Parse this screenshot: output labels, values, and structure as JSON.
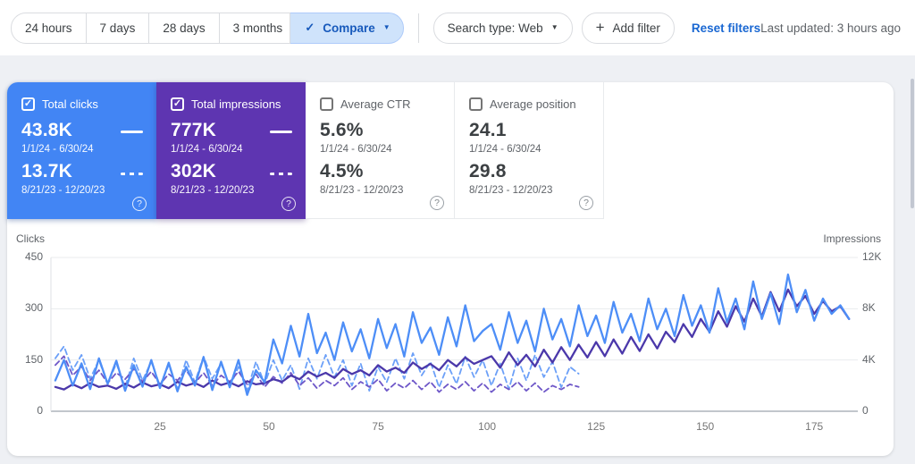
{
  "toolbar": {
    "time_ranges": [
      "24 hours",
      "7 days",
      "28 days",
      "3 months"
    ],
    "compare_label": "Compare",
    "search_type_label": "Search type: Web",
    "add_filter_label": "Add filter",
    "reset_filters_label": "Reset filters",
    "last_updated": "Last updated: 3 hours ago"
  },
  "icons": {
    "check": "✓",
    "caret_down": "▼",
    "plus": "+",
    "question": "?"
  },
  "colors": {
    "clicks_card": "#4285f4",
    "impressions_card": "#5e35b1",
    "compare_bg": "#cfe3fb",
    "link_blue": "#1967d2",
    "clicks_line": "#4d8ef7",
    "clicks_line_prev": "#6ca0f8",
    "impressions_line": "#4b38aa",
    "impressions_line_prev": "#6e57c8"
  },
  "cards": [
    {
      "label": "Total clicks",
      "checked": true,
      "current_value": "43.8K",
      "current_range": "1/1/24 - 6/30/24",
      "previous_value": "13.7K",
      "previous_range": "8/21/23 - 12/20/23"
    },
    {
      "label": "Total impressions",
      "checked": true,
      "current_value": "777K",
      "current_range": "1/1/24 - 6/30/24",
      "previous_value": "302K",
      "previous_range": "8/21/23 - 12/20/23"
    },
    {
      "label": "Average CTR",
      "checked": false,
      "current_value": "5.6%",
      "current_range": "1/1/24 - 6/30/24",
      "previous_value": "4.5%",
      "previous_range": "8/21/23 - 12/20/23"
    },
    {
      "label": "Average position",
      "checked": false,
      "current_value": "24.1",
      "current_range": "1/1/24 - 6/30/24",
      "previous_value": "29.8",
      "previous_range": "8/21/23 - 12/20/23"
    }
  ],
  "chart_data": {
    "type": "line",
    "left_axis": {
      "label": "Clicks",
      "max": 450,
      "tick_values": [
        450,
        300,
        150,
        0
      ],
      "tick_labels": [
        "450",
        "300",
        "150",
        "0"
      ]
    },
    "right_axis": {
      "label": "Impressions",
      "max": 12000,
      "tick_values": [
        12000,
        8000,
        4000,
        0
      ],
      "tick_labels": [
        "12K",
        "8K",
        "4K",
        "0"
      ]
    },
    "x_axis": {
      "max": 185,
      "tick_values": [
        25,
        50,
        75,
        100,
        125,
        150,
        175
      ],
      "tick_labels": [
        "25",
        "50",
        "75",
        "100",
        "125",
        "150",
        "175"
      ]
    },
    "grid": "horizontal",
    "series": [
      {
        "name": "Clicks 1/1/24 - 6/30/24",
        "axis": "left",
        "style": "solid",
        "color": "#4d8ef7",
        "x_start": 1,
        "x_step": 2,
        "values": [
          90,
          150,
          75,
          140,
          65,
          155,
          80,
          148,
          60,
          135,
          72,
          150,
          68,
          142,
          58,
          130,
          75,
          158,
          62,
          145,
          70,
          150,
          48,
          120,
          85,
          210,
          140,
          250,
          160,
          285,
          170,
          230,
          150,
          260,
          175,
          240,
          155,
          270,
          185,
          255,
          160,
          290,
          200,
          245,
          165,
          275,
          190,
          310,
          205,
          235,
          255,
          180,
          290,
          200,
          265,
          175,
          300,
          210,
          270,
          190,
          310,
          220,
          280,
          200,
          320,
          230,
          285,
          205,
          330,
          240,
          300,
          220,
          340,
          250,
          310,
          230,
          360,
          260,
          330,
          240,
          380,
          270,
          345,
          255,
          400,
          290,
          355,
          265,
          330,
          285,
          310,
          270
        ]
      },
      {
        "name": "Clicks 8/21/23 - 12/20/23",
        "axis": "left",
        "style": "dashed",
        "color": "#6ca0f8",
        "x_start": 1,
        "x_step": 2,
        "values": [
          155,
          190,
          120,
          165,
          95,
          150,
          80,
          140,
          70,
          155,
          90,
          145,
          75,
          135,
          65,
          150,
          85,
          160,
          95,
          140,
          70,
          130,
          60,
          145,
          80,
          150,
          90,
          135,
          65,
          155,
          95,
          165,
          100,
          150,
          75,
          140,
          60,
          130,
          85,
          155,
          95,
          170,
          105,
          145,
          70,
          135,
          80,
          160,
          100,
          150,
          75,
          140,
          65,
          155,
          90,
          165,
          100,
          145,
          70,
          130,
          110
        ]
      },
      {
        "name": "Impressions 1/1/24 - 6/30/24",
        "axis": "right",
        "style": "solid",
        "color": "#4b38aa",
        "x_start": 1,
        "x_step": 2,
        "values": [
          1900,
          1700,
          2100,
          1800,
          2200,
          1900,
          2000,
          1750,
          2150,
          1850,
          2250,
          1950,
          2100,
          1800,
          2300,
          2000,
          2200,
          1900,
          2400,
          2050,
          2250,
          1950,
          2350,
          2100,
          2200,
          2500,
          2300,
          2800,
          2500,
          3100,
          2700,
          3000,
          2600,
          3300,
          2900,
          3200,
          2800,
          3600,
          3100,
          3400,
          3000,
          3800,
          3300,
          3700,
          3200,
          4000,
          3500,
          4200,
          3700,
          4000,
          4300,
          3400,
          4600,
          3600,
          4400,
          3500,
          4800,
          3800,
          5000,
          4000,
          5200,
          4200,
          5400,
          4300,
          5600,
          4500,
          5800,
          4700,
          6000,
          4900,
          6200,
          5400,
          6800,
          5800,
          7200,
          6200,
          7800,
          6600,
          8200,
          7000,
          8800,
          7400,
          9300,
          7800,
          9500,
          8200,
          9000,
          7600,
          8600,
          7800,
          8200,
          7200
        ]
      },
      {
        "name": "Impressions 8/21/23 - 12/20/23",
        "axis": "right",
        "style": "dashed",
        "color": "#6e57c8",
        "x_start": 1,
        "x_step": 2,
        "values": [
          3600,
          4300,
          2800,
          3500,
          2400,
          3200,
          2200,
          3000,
          2500,
          3300,
          2300,
          3100,
          2100,
          2900,
          2400,
          3200,
          2200,
          3000,
          2000,
          2800,
          2300,
          3100,
          2100,
          2900,
          1900,
          2700,
          2200,
          3000,
          2000,
          2600,
          1800,
          2400,
          2000,
          2600,
          1700,
          2300,
          1900,
          2500,
          1600,
          2200,
          1800,
          2400,
          1700,
          2300,
          1500,
          2100,
          1700,
          2300,
          1600,
          2200,
          1500,
          2100,
          1700,
          2300,
          1600,
          2200,
          1500,
          2000,
          1700,
          2100,
          1900
        ]
      }
    ]
  }
}
